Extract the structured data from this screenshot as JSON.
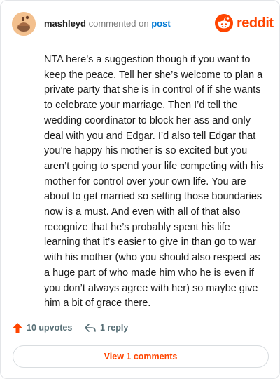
{
  "comment": {
    "username": "mashleyd",
    "commented_text": " commented on ",
    "post_link": "post",
    "body": "NTA here’s a suggestion though if you want to keep the peace. Tell her she’s welcome to plan a private party that she is in control of if she wants to celebrate your marriage. Then I’d tell the wedding coordinator to block her ass and only deal with you and Edgar. I’d also tell Edgar that you’re happy his mother is so excited but you aren’t going to spend your life competing with his mother for control over your own life. You are about to get married so setting those boundaries now is a must. And even with all of that also recognize that he’s probably spent his life learning that it’s easier to give in than go to war with his mother (who you should also respect as a huge part of who made him who he is even if you don’t always agree with her) so maybe give him a bit of grace there."
  },
  "brand": {
    "wordmark": "reddit",
    "accent_color": "#ff4500",
    "icon": "reddit-snoo-icon"
  },
  "actions": {
    "upvotes_label": "10 upvotes",
    "reply_label": "1 reply",
    "upvote_icon": "upvote-arrow-icon",
    "reply_icon": "reply-arrow-icon"
  },
  "footer": {
    "view_comments_label": "View 1 comments"
  }
}
